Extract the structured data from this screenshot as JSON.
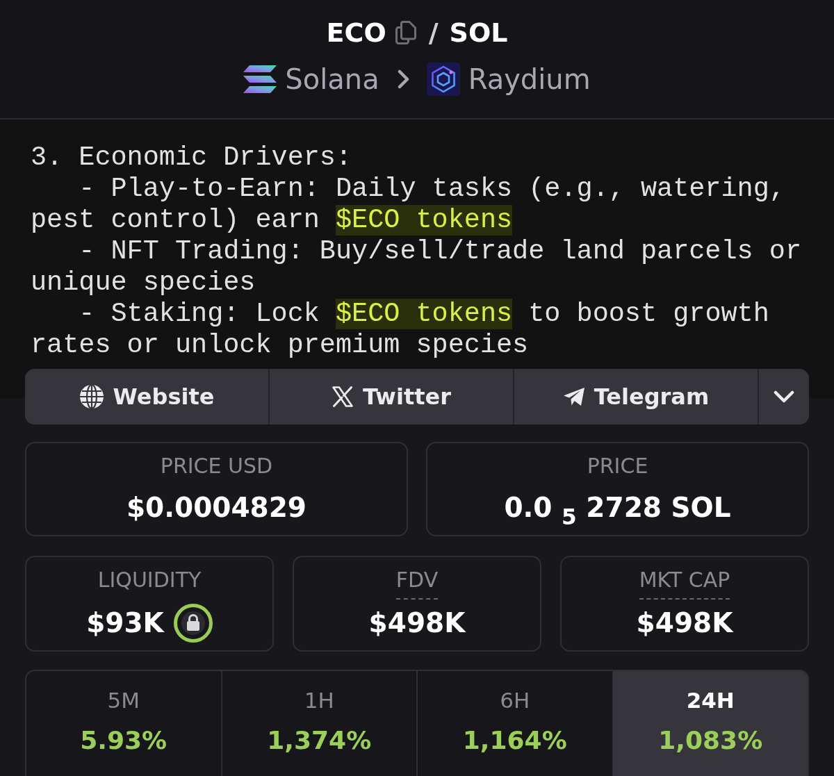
{
  "header": {
    "base_token": "ECO",
    "separator": "/",
    "quote_token": "SOL",
    "chain": "Solana",
    "dex": "Raydium"
  },
  "banner": {
    "lines": [
      {
        "segments": [
          {
            "text": "3. Economic Drivers:",
            "highlighted": false
          }
        ]
      },
      {
        "segments": [
          {
            "text": "   - Play-to-Earn: Daily tasks (e.g., watering,",
            "highlighted": false
          }
        ]
      },
      {
        "segments": [
          {
            "text": "pest control) earn ",
            "highlighted": false
          },
          {
            "text": "$ECO tokens",
            "highlighted": true
          }
        ]
      },
      {
        "segments": [
          {
            "text": "   - NFT Trading: Buy/sell/trade land parcels or",
            "highlighted": false
          }
        ]
      },
      {
        "segments": [
          {
            "text": "unique species",
            "highlighted": false
          }
        ]
      },
      {
        "segments": [
          {
            "text": "   - Staking: Lock ",
            "highlighted": false
          },
          {
            "text": "$ECO tokens",
            "highlighted": true
          },
          {
            "text": " to boost growth",
            "highlighted": false
          }
        ]
      },
      {
        "segments": [
          {
            "text": "rates or unlock premium species",
            "highlighted": false
          }
        ]
      }
    ]
  },
  "links": [
    {
      "label": "Website",
      "kind": "website"
    },
    {
      "label": "Twitter",
      "kind": "twitter"
    },
    {
      "label": "Telegram",
      "kind": "telegram"
    }
  ],
  "price_cards": [
    {
      "label": "PRICE USD",
      "value": "$0.0004829"
    },
    {
      "label": "PRICE",
      "value": "0.0 $_{5}$ 2728 SOL"
    }
  ],
  "metric_cards": [
    {
      "label": "LIQUIDITY",
      "value": "$93K",
      "locked": true,
      "underlined": false
    },
    {
      "label": "FDV",
      "value": "$498K",
      "locked": false,
      "underlined": true
    },
    {
      "label": "MKT CAP",
      "value": "$498K",
      "locked": false,
      "underlined": true
    }
  ],
  "changes": [
    {
      "period": "5M",
      "value": "5.93%",
      "selected": false
    },
    {
      "period": "1H",
      "value": "1,374%",
      "selected": false
    },
    {
      "period": "6H",
      "value": "1,164%",
      "selected": false
    },
    {
      "period": "24H",
      "value": "1,083%",
      "selected": true
    }
  ]
}
